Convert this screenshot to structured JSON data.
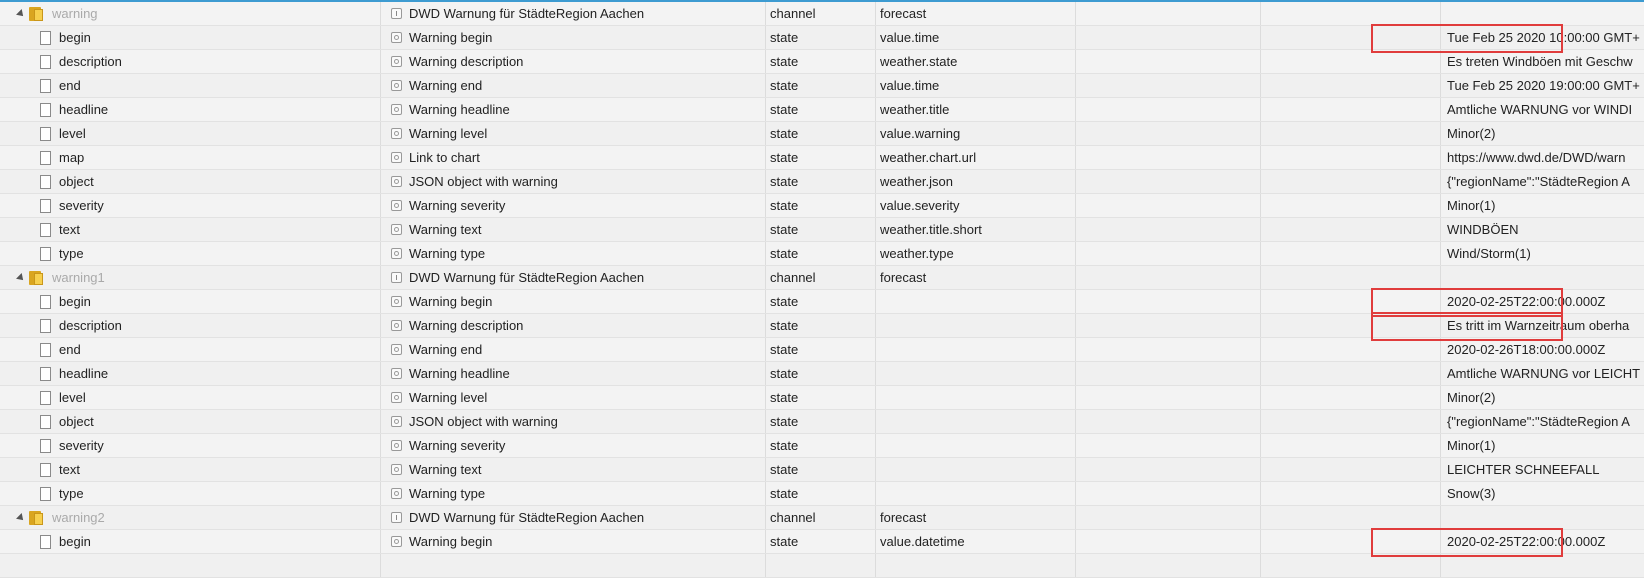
{
  "rows": [
    {
      "kind": "folder",
      "name": "warning",
      "title": "DWD Warnung für StädteRegion Aachen",
      "type": "channel",
      "role": "forecast",
      "value": ""
    },
    {
      "kind": "leaf",
      "name": "begin",
      "title": "Warning begin",
      "type": "state",
      "role": "value.time",
      "value": "Tue Feb 25 2020 10:00:00 GMT+"
    },
    {
      "kind": "leaf",
      "name": "description",
      "title": "Warning description",
      "type": "state",
      "role": "weather.state",
      "value": "Es treten Windböen mit Geschw"
    },
    {
      "kind": "leaf",
      "name": "end",
      "title": "Warning end",
      "type": "state",
      "role": "value.time",
      "value": "Tue Feb 25 2020 19:00:00 GMT+"
    },
    {
      "kind": "leaf",
      "name": "headline",
      "title": "Warning headline",
      "type": "state",
      "role": "weather.title",
      "value": "Amtliche WARNUNG vor WINDI"
    },
    {
      "kind": "leaf",
      "name": "level",
      "title": "Warning level",
      "type": "state",
      "role": "value.warning",
      "value": "Minor(2)"
    },
    {
      "kind": "leaf",
      "name": "map",
      "title": "Link to chart",
      "type": "state",
      "role": "weather.chart.url",
      "value": "https://www.dwd.de/DWD/warn"
    },
    {
      "kind": "leaf",
      "name": "object",
      "title": "JSON object with warning",
      "type": "state",
      "role": "weather.json",
      "value": "{\"regionName\":\"StädteRegion A"
    },
    {
      "kind": "leaf",
      "name": "severity",
      "title": "Warning severity",
      "type": "state",
      "role": "value.severity",
      "value": "Minor(1)"
    },
    {
      "kind": "leaf",
      "name": "text",
      "title": "Warning text",
      "type": "state",
      "role": "weather.title.short",
      "value": "WINDBÖEN"
    },
    {
      "kind": "leaf",
      "name": "type",
      "title": "Warning type",
      "type": "state",
      "role": "weather.type",
      "value": "Wind/Storm(1)"
    },
    {
      "kind": "folder",
      "name": "warning1",
      "title": "DWD Warnung für StädteRegion Aachen",
      "type": "channel",
      "role": "forecast",
      "value": ""
    },
    {
      "kind": "leaf",
      "name": "begin",
      "title": "Warning begin",
      "type": "state",
      "role": "",
      "value": "2020-02-25T22:00:00.000Z"
    },
    {
      "kind": "leaf",
      "name": "description",
      "title": "Warning description",
      "type": "state",
      "role": "",
      "value": "Es tritt im Warnzeitraum oberha"
    },
    {
      "kind": "leaf",
      "name": "end",
      "title": "Warning end",
      "type": "state",
      "role": "",
      "value": "2020-02-26T18:00:00.000Z"
    },
    {
      "kind": "leaf",
      "name": "headline",
      "title": "Warning headline",
      "type": "state",
      "role": "",
      "value": "Amtliche WARNUNG vor LEICHT"
    },
    {
      "kind": "leaf",
      "name": "level",
      "title": "Warning level",
      "type": "state",
      "role": "",
      "value": "Minor(2)"
    },
    {
      "kind": "leaf",
      "name": "object",
      "title": "JSON object with warning",
      "type": "state",
      "role": "",
      "value": "{\"regionName\":\"StädteRegion A"
    },
    {
      "kind": "leaf",
      "name": "severity",
      "title": "Warning severity",
      "type": "state",
      "role": "",
      "value": "Minor(1)"
    },
    {
      "kind": "leaf",
      "name": "text",
      "title": "Warning text",
      "type": "state",
      "role": "",
      "value": "LEICHTER SCHNEEFALL"
    },
    {
      "kind": "leaf",
      "name": "type",
      "title": "Warning type",
      "type": "state",
      "role": "",
      "value": "Snow(3)"
    },
    {
      "kind": "folder",
      "name": "warning2",
      "title": "DWD Warnung für StädteRegion Aachen",
      "type": "channel",
      "role": "forecast",
      "value": ""
    },
    {
      "kind": "leaf",
      "name": "begin",
      "title": "Warning begin",
      "type": "state",
      "role": "value.datetime",
      "value": "2020-02-25T22:00:00.000Z"
    },
    {
      "kind": "leaf",
      "name": "",
      "title": "",
      "type": "",
      "role": "",
      "value": ""
    }
  ],
  "highlight_rows": [
    1,
    12,
    13,
    22
  ],
  "highlight_color": "#e03c3c",
  "accent_color": "#3d9bd1",
  "icons": {
    "expand": "triangle-down-icon",
    "folder": "folder-icon",
    "file": "file-icon",
    "channel": "channel-icon",
    "state": "state-icon"
  }
}
